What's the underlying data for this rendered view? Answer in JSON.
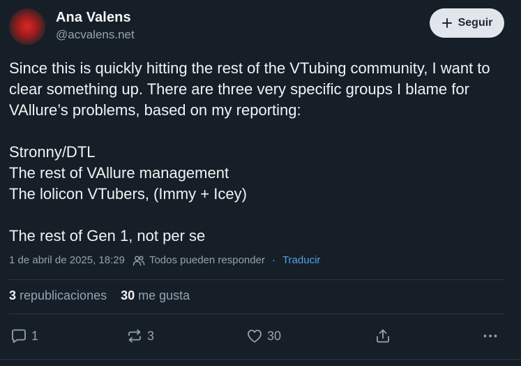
{
  "author": {
    "name": "Ana Valens",
    "handle": "@acvalens.net"
  },
  "follow": {
    "label": "Seguir"
  },
  "post": {
    "paragraphs": [
      "Since this is quickly hitting the rest of the VTubing community, I want to clear something up. There are three very specific groups I blame for VAllure’s problems, based on my reporting:",
      "Stronny/DTL",
      "The rest of VAllure management",
      "The lolicon VTubers, (Immy + Icey)",
      "The rest of Gen 1, not per se"
    ],
    "timestamp": "1 de abril de 2025, 18:29",
    "reply_setting": "Todos pueden responder",
    "separator": "·",
    "translate_label": "Traducir"
  },
  "stats": {
    "reposts_count": "3",
    "reposts_label": "republicaciones",
    "likes_count": "30",
    "likes_label": "me gusta"
  },
  "actions": {
    "reply_count": "1",
    "repost_count": "3",
    "like_count": "30"
  },
  "icons": {
    "follow": "plus-icon",
    "reply_setting": "people-icon",
    "reply": "speech-bubble-icon",
    "repost": "repost-arrows-icon",
    "like": "heart-icon",
    "share": "share-icon",
    "more": "more-dots-icon"
  },
  "colors": {
    "background": "#161e27",
    "accent_link": "#4ea3ef",
    "muted_text": "#94a3b3",
    "follow_button_bg": "#e1e6ec"
  }
}
